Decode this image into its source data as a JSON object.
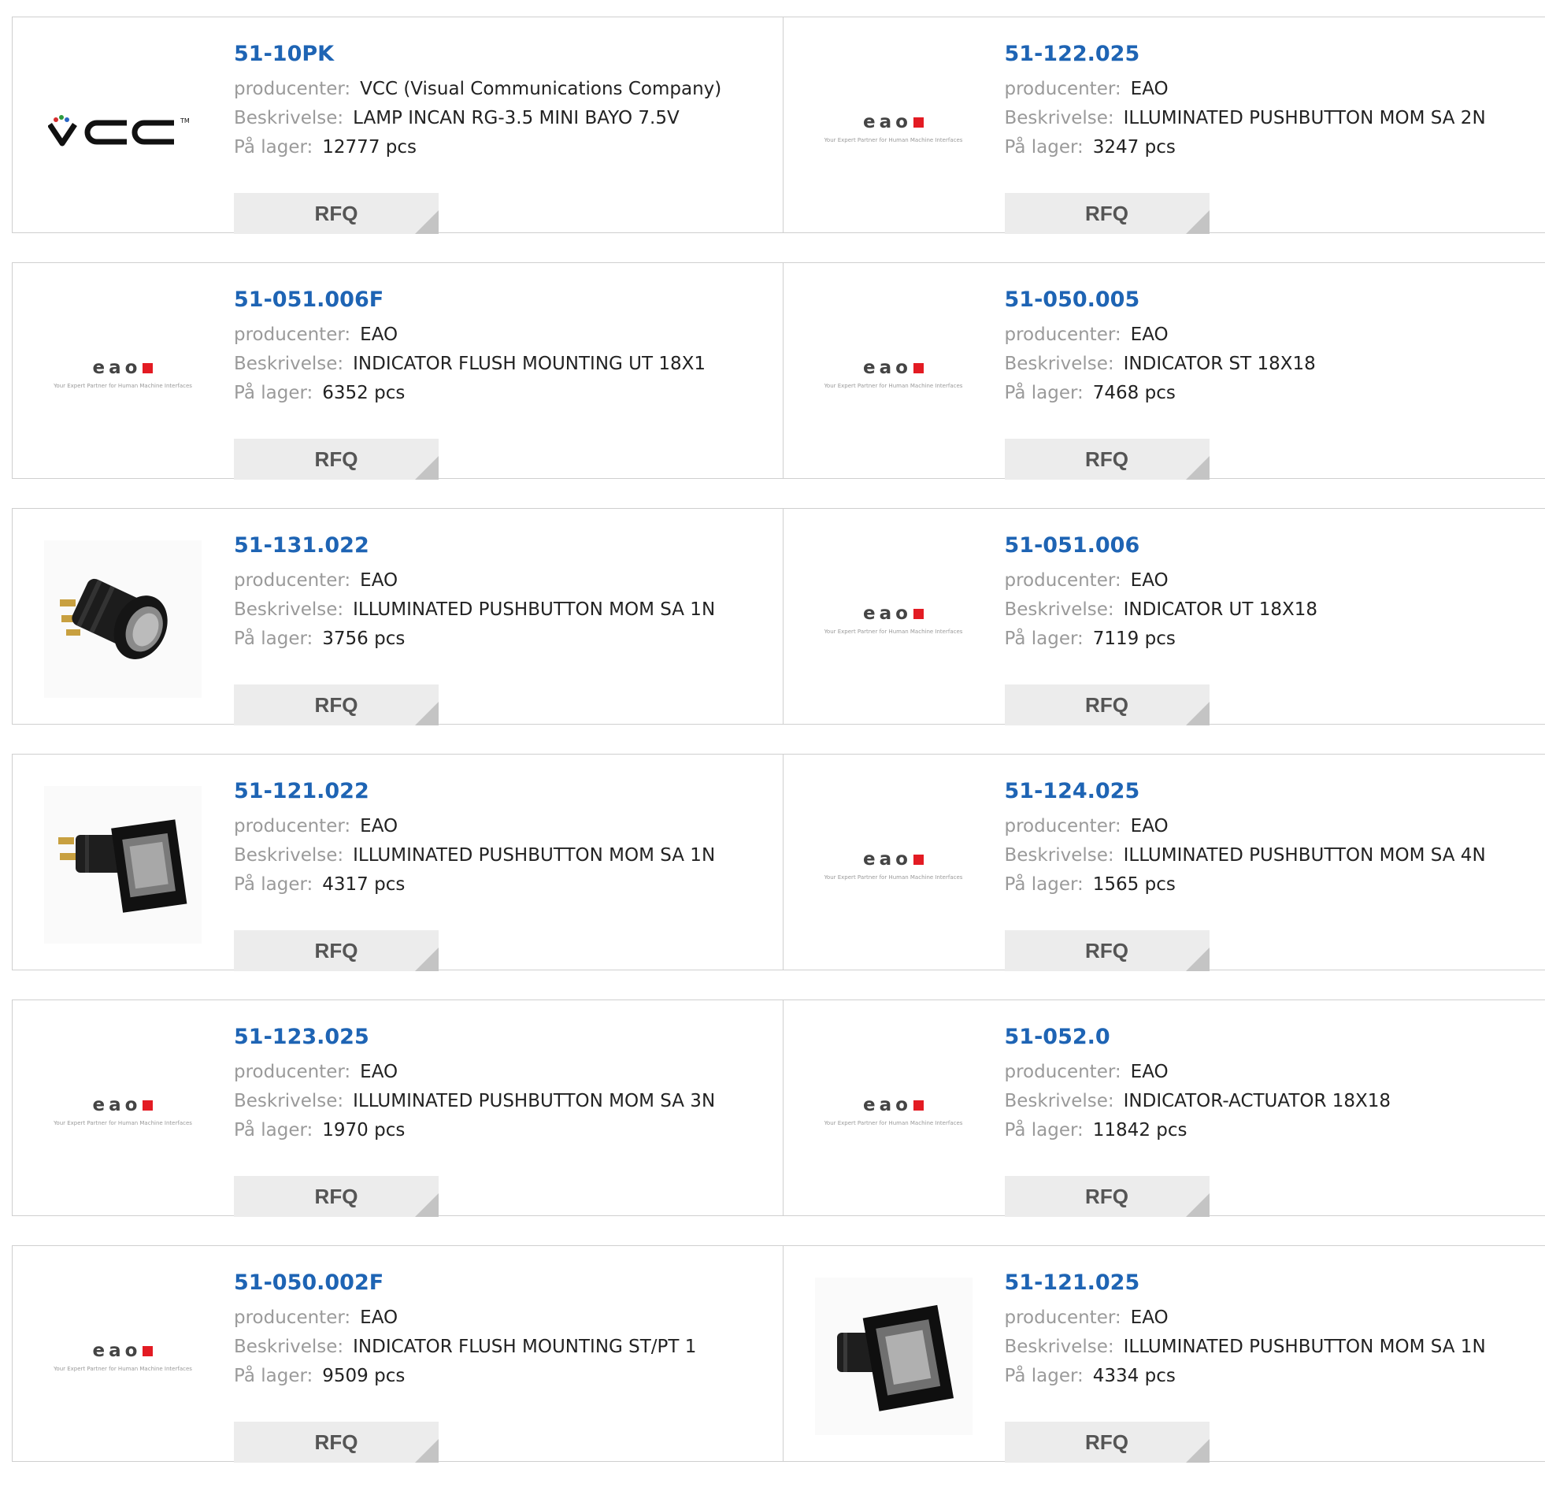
{
  "labels": {
    "manufacturer": "producenter:",
    "description": "Beskrivelse:",
    "stock": "På lager:",
    "rfq": "RFQ"
  },
  "brand": {
    "eao_word": "eao",
    "eao_tagline": "Your Expert Partner for Human Machine Interfaces"
  },
  "colors": {
    "part_number": "#1e64b4",
    "eao_red": "#e31b23"
  },
  "products": [
    {
      "part": "51-10PK",
      "manufacturer": "VCC (Visual Communications Company)",
      "description": "LAMP INCAN RG-3.5 MINI BAYO 7.5V",
      "stock": "12777 pcs",
      "image": "vcc-logo"
    },
    {
      "part": "51-122.025",
      "manufacturer": "EAO",
      "description": "ILLUMINATED PUSHBUTTON MOM SA 2N",
      "stock": "3247 pcs",
      "image": "eao-logo"
    },
    {
      "part": "51-051.006F",
      "manufacturer": "EAO",
      "description": "INDICATOR FLUSH MOUNTING UT 18X1",
      "stock": "6352 pcs",
      "image": "eao-logo"
    },
    {
      "part": "51-050.005",
      "manufacturer": "EAO",
      "description": "INDICATOR ST 18X18",
      "stock": "7468 pcs",
      "image": "eao-logo"
    },
    {
      "part": "51-131.022",
      "manufacturer": "EAO",
      "description": "ILLUMINATED PUSHBUTTON MOM SA 1N",
      "stock": "3756 pcs",
      "image": "round-pushbutton-photo"
    },
    {
      "part": "51-051.006",
      "manufacturer": "EAO",
      "description": "INDICATOR UT 18X18",
      "stock": "7119 pcs",
      "image": "eao-logo"
    },
    {
      "part": "51-121.022",
      "manufacturer": "EAO",
      "description": "ILLUMINATED PUSHBUTTON MOM SA 1N",
      "stock": "4317 pcs",
      "image": "square-pushbutton-photo"
    },
    {
      "part": "51-124.025",
      "manufacturer": "EAO",
      "description": "ILLUMINATED PUSHBUTTON MOM SA 4N",
      "stock": "1565 pcs",
      "image": "eao-logo"
    },
    {
      "part": "51-123.025",
      "manufacturer": "EAO",
      "description": "ILLUMINATED PUSHBUTTON MOM SA 3N",
      "stock": "1970 pcs",
      "image": "eao-logo"
    },
    {
      "part": "51-052.0",
      "manufacturer": "EAO",
      "description": "INDICATOR-ACTUATOR 18X18",
      "stock": "11842 pcs",
      "image": "eao-logo"
    },
    {
      "part": "51-050.002F",
      "manufacturer": "EAO",
      "description": "INDICATOR FLUSH MOUNTING ST/PT 1",
      "stock": "9509 pcs",
      "image": "eao-logo"
    },
    {
      "part": "51-121.025",
      "manufacturer": "EAO",
      "description": "ILLUMINATED PUSHBUTTON MOM SA 1N",
      "stock": "4334 pcs",
      "image": "square-pushbutton-front-photo"
    }
  ]
}
